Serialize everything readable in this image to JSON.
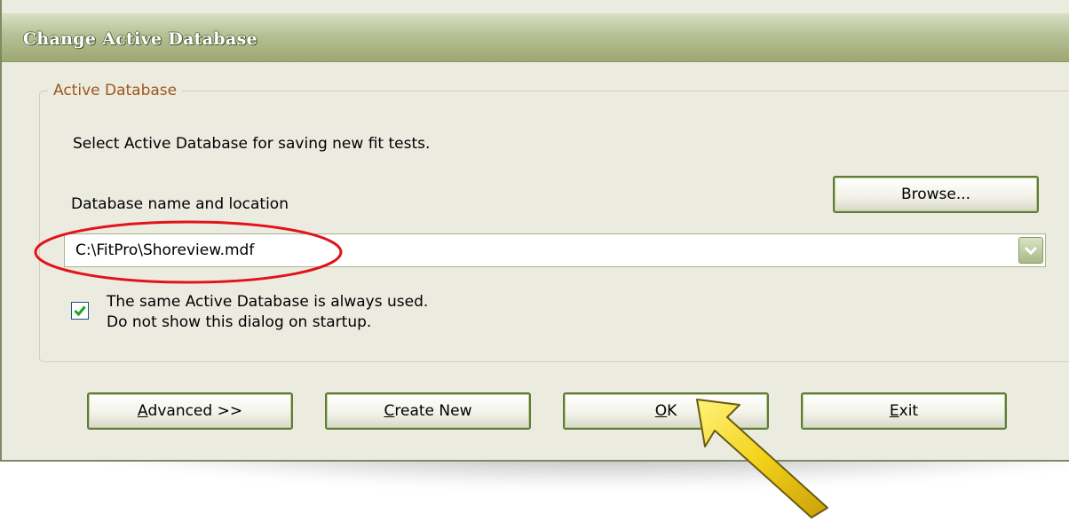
{
  "dialog": {
    "title": "Change Active Database"
  },
  "group": {
    "legend": "Active Database",
    "description": "Select Active Database for saving new fit tests.",
    "location_label": "Database name and location",
    "browse_label": "Browse...",
    "database_value": "C:\\FitPro\\Shoreview.mdf",
    "always_used_line1": "The same Active Database is always used.",
    "always_used_line2": "Do not show this dialog on startup.",
    "always_used_checked": true
  },
  "buttons": {
    "advanced_mnemonic": "A",
    "advanced_rest": "dvanced >>",
    "create_mnemonic": "C",
    "create_rest": "reate New",
    "ok_mnemonic": "O",
    "ok_rest": "K",
    "exit_mnemonic": "E",
    "exit_rest": "xit"
  },
  "colors": {
    "titlebar": "#9ea873",
    "legend_text": "#a0561c",
    "annotation_ellipse": "#e0141a",
    "annotation_arrow": "#f2d21a"
  },
  "icons": {
    "combo_arrow": "chevron-down-icon",
    "checkbox_mark": "checkmark-icon",
    "annotation": "pointer-arrow-icon"
  }
}
